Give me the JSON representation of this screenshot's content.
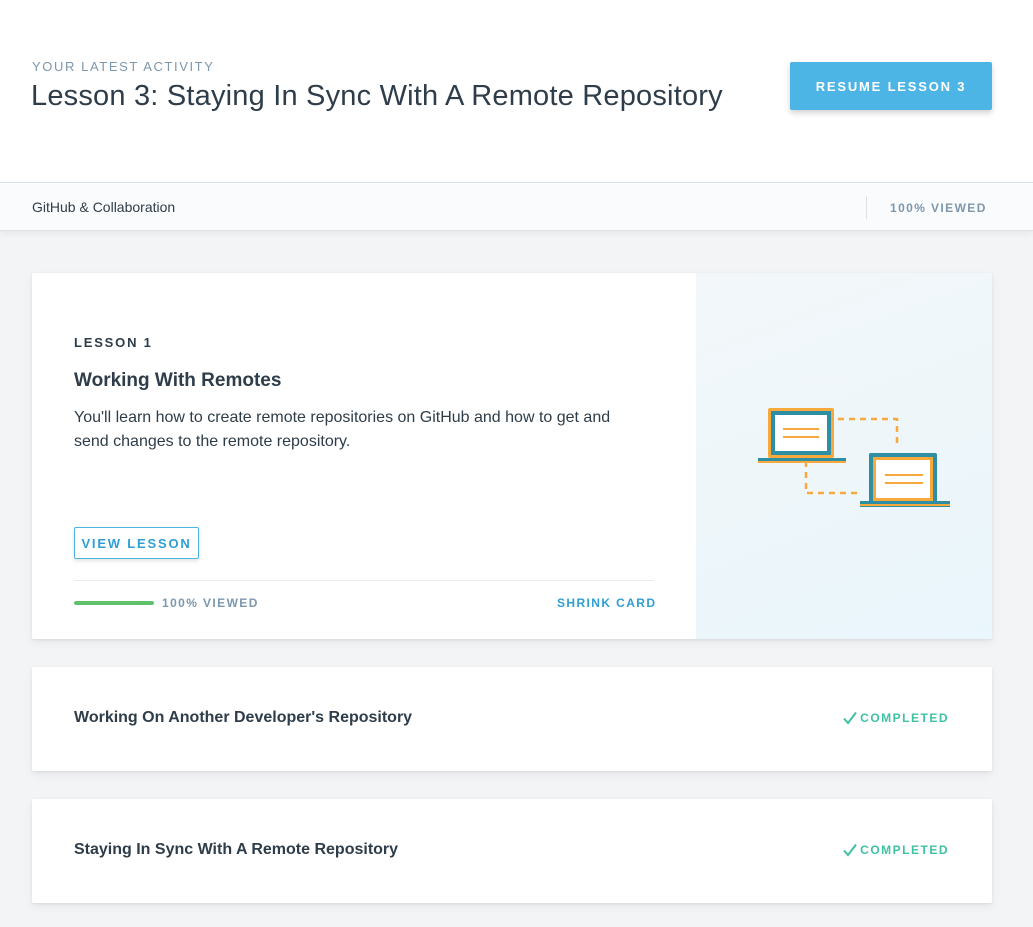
{
  "hero": {
    "eyebrow": "YOUR LATEST ACTIVITY",
    "title": "Lesson 3: Staying In Sync With A Remote Repository",
    "resume_button": "RESUME LESSON 3"
  },
  "subbar": {
    "course_name": "GitHub & Collaboration",
    "status": "100% VIEWED"
  },
  "expanded_card": {
    "lesson_number": "LESSON 1",
    "title": "Working With Remotes",
    "description": "You'll learn how to create remote repositories on GitHub and how to get and send changes to the remote repository.",
    "view_button": "VIEW LESSON",
    "progress_fraction": 1.0,
    "progress_label": "100% VIEWED",
    "shrink_label": "SHRINK CARD",
    "illustration_icon": "laptops-sync-icon"
  },
  "lessons": [
    {
      "title": "Working On Another Developer's Repository",
      "status": "COMPLETED",
      "status_icon": "checkmark-icon"
    },
    {
      "title": "Staying In Sync With A Remote Repository",
      "status": "COMPLETED",
      "status_icon": "checkmark-icon"
    }
  ],
  "colors": {
    "accent": "#4cb5e5",
    "accent_text": "#2f9fd3",
    "progress": "#5fc16b",
    "completed": "#3fc1a3",
    "muted": "#7d97ad",
    "text": "#2e3d49",
    "illustration_frame": "#2e8ea4",
    "illustration_accent": "#f7a93b"
  }
}
